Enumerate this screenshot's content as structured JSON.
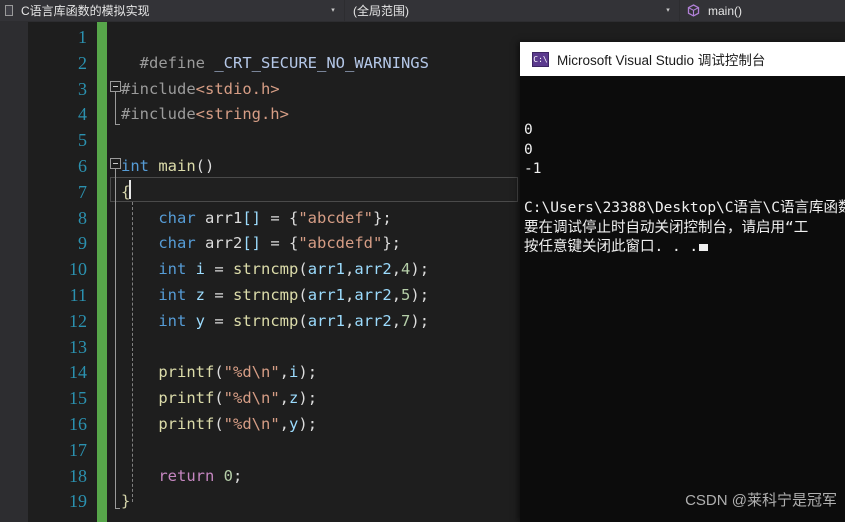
{
  "navbar": {
    "project_combo": {
      "icon": "document-icon",
      "value": "C语言库函数的模拟实现",
      "arrow": "▾"
    },
    "scope_combo": {
      "value": "(全局范围)",
      "arrow": "▾"
    },
    "member_combo": {
      "icon": "method-cube-icon",
      "value": "main()"
    }
  },
  "editor": {
    "line_numbers": [
      "1",
      "2",
      "3",
      "4",
      "5",
      "6",
      "7",
      "8",
      "9",
      "10",
      "11",
      "12",
      "13",
      "14",
      "15",
      "16",
      "17",
      "18",
      "19"
    ],
    "lines": [
      {
        "n": "1",
        "tokens": []
      },
      {
        "n": "2",
        "tokens": [
          {
            "t": "  ",
            "c": "pl"
          },
          {
            "t": "#define",
            "c": "pp"
          },
          {
            "t": " ",
            "c": "pl"
          },
          {
            "t": "_CRT_SECURE_NO_WARNINGS",
            "c": "macro"
          }
        ]
      },
      {
        "n": "3",
        "tokens": [
          {
            "t": "#include",
            "c": "pp"
          },
          {
            "t": "<stdio.h>",
            "c": "str"
          }
        ]
      },
      {
        "n": "4",
        "tokens": [
          {
            "t": "#include",
            "c": "pp"
          },
          {
            "t": "<string.h>",
            "c": "str"
          }
        ]
      },
      {
        "n": "5",
        "tokens": []
      },
      {
        "n": "6",
        "tokens": [
          {
            "t": "int",
            "c": "kw"
          },
          {
            "t": " ",
            "c": "pl"
          },
          {
            "t": "main",
            "c": "fn"
          },
          {
            "t": "()",
            "c": "pl"
          }
        ]
      },
      {
        "n": "7",
        "tokens": [
          {
            "t": "{",
            "c": "br"
          }
        ]
      },
      {
        "n": "8",
        "tokens": [
          {
            "t": "    ",
            "c": "pl"
          },
          {
            "t": "char",
            "c": "kw"
          },
          {
            "t": " ",
            "c": "pl"
          },
          {
            "t": "arr1",
            "c": "pl"
          },
          {
            "t": "[]",
            "c": "var"
          },
          {
            "t": " = ",
            "c": "pl"
          },
          {
            "t": "{",
            "c": "pl"
          },
          {
            "t": "\"abcdef\"",
            "c": "str"
          },
          {
            "t": "};",
            "c": "pl"
          }
        ]
      },
      {
        "n": "9",
        "tokens": [
          {
            "t": "    ",
            "c": "pl"
          },
          {
            "t": "char",
            "c": "kw"
          },
          {
            "t": " ",
            "c": "pl"
          },
          {
            "t": "arr2",
            "c": "pl"
          },
          {
            "t": "[]",
            "c": "var"
          },
          {
            "t": " = ",
            "c": "pl"
          },
          {
            "t": "{",
            "c": "pl"
          },
          {
            "t": "\"abcdefd\"",
            "c": "str"
          },
          {
            "t": "};",
            "c": "pl"
          }
        ]
      },
      {
        "n": "10",
        "tokens": [
          {
            "t": "    ",
            "c": "pl"
          },
          {
            "t": "int",
            "c": "kw"
          },
          {
            "t": " ",
            "c": "pl"
          },
          {
            "t": "i",
            "c": "var"
          },
          {
            "t": " = ",
            "c": "pl"
          },
          {
            "t": "strncmp",
            "c": "fn"
          },
          {
            "t": "(",
            "c": "pl"
          },
          {
            "t": "arr1",
            "c": "var"
          },
          {
            "t": ",",
            "c": "pl"
          },
          {
            "t": "arr2",
            "c": "var"
          },
          {
            "t": ",",
            "c": "pl"
          },
          {
            "t": "4",
            "c": "num"
          },
          {
            "t": ");",
            "c": "pl"
          }
        ]
      },
      {
        "n": "11",
        "tokens": [
          {
            "t": "    ",
            "c": "pl"
          },
          {
            "t": "int",
            "c": "kw"
          },
          {
            "t": " ",
            "c": "pl"
          },
          {
            "t": "z",
            "c": "var"
          },
          {
            "t": " = ",
            "c": "pl"
          },
          {
            "t": "strncmp",
            "c": "fn"
          },
          {
            "t": "(",
            "c": "pl"
          },
          {
            "t": "arr1",
            "c": "var"
          },
          {
            "t": ",",
            "c": "pl"
          },
          {
            "t": "arr2",
            "c": "var"
          },
          {
            "t": ",",
            "c": "pl"
          },
          {
            "t": "5",
            "c": "num"
          },
          {
            "t": ");",
            "c": "pl"
          }
        ]
      },
      {
        "n": "12",
        "tokens": [
          {
            "t": "    ",
            "c": "pl"
          },
          {
            "t": "int",
            "c": "kw"
          },
          {
            "t": " ",
            "c": "pl"
          },
          {
            "t": "y",
            "c": "var"
          },
          {
            "t": " = ",
            "c": "pl"
          },
          {
            "t": "strncmp",
            "c": "fn"
          },
          {
            "t": "(",
            "c": "pl"
          },
          {
            "t": "arr1",
            "c": "var"
          },
          {
            "t": ",",
            "c": "pl"
          },
          {
            "t": "arr2",
            "c": "var"
          },
          {
            "t": ",",
            "c": "pl"
          },
          {
            "t": "7",
            "c": "num"
          },
          {
            "t": ");",
            "c": "pl"
          }
        ]
      },
      {
        "n": "13",
        "tokens": []
      },
      {
        "n": "14",
        "tokens": [
          {
            "t": "    ",
            "c": "pl"
          },
          {
            "t": "printf",
            "c": "fn"
          },
          {
            "t": "(",
            "c": "pl"
          },
          {
            "t": "\"%d\\n\"",
            "c": "str"
          },
          {
            "t": ",",
            "c": "pl"
          },
          {
            "t": "i",
            "c": "var"
          },
          {
            "t": ");",
            "c": "pl"
          }
        ]
      },
      {
        "n": "15",
        "tokens": [
          {
            "t": "    ",
            "c": "pl"
          },
          {
            "t": "printf",
            "c": "fn"
          },
          {
            "t": "(",
            "c": "pl"
          },
          {
            "t": "\"%d\\n\"",
            "c": "str"
          },
          {
            "t": ",",
            "c": "pl"
          },
          {
            "t": "z",
            "c": "var"
          },
          {
            "t": ");",
            "c": "pl"
          }
        ]
      },
      {
        "n": "16",
        "tokens": [
          {
            "t": "    ",
            "c": "pl"
          },
          {
            "t": "printf",
            "c": "fn"
          },
          {
            "t": "(",
            "c": "pl"
          },
          {
            "t": "\"%d\\n\"",
            "c": "str"
          },
          {
            "t": ",",
            "c": "pl"
          },
          {
            "t": "y",
            "c": "var"
          },
          {
            "t": ");",
            "c": "pl"
          }
        ]
      },
      {
        "n": "17",
        "tokens": []
      },
      {
        "n": "18",
        "tokens": [
          {
            "t": "    ",
            "c": "pl"
          },
          {
            "t": "return",
            "c": "kw2"
          },
          {
            "t": " ",
            "c": "pl"
          },
          {
            "t": "0",
            "c": "num"
          },
          {
            "t": ";",
            "c": "pl"
          }
        ]
      },
      {
        "n": "19",
        "tokens": [
          {
            "t": "}",
            "c": "br"
          }
        ]
      }
    ],
    "fold_markers": [
      "line-3-collapse",
      "line-6-collapse"
    ],
    "current_line": "7"
  },
  "console": {
    "icon": "cmd-console-icon",
    "icon_glyph": "C:\\",
    "title": "Microsoft Visual Studio 调试控制台",
    "output": [
      "0",
      "0",
      "-1",
      "",
      "C:\\Users\\23388\\Desktop\\C语言\\C语言库函数",
      "要在调试停止时自动关闭控制台，请启用“工",
      "按任意键关闭此窗口. . ."
    ]
  },
  "watermark": {
    "text": "CSDN @莱科宁是冠军"
  },
  "colors": {
    "navbar_bg": "#3f3f46",
    "editor_bg": "#1e1e1e",
    "changebar_green": "#57a64a",
    "linenumber_teal": "#2b91af",
    "console_bg": "#0c0c0c",
    "console_title_bg": "#ffffff"
  }
}
